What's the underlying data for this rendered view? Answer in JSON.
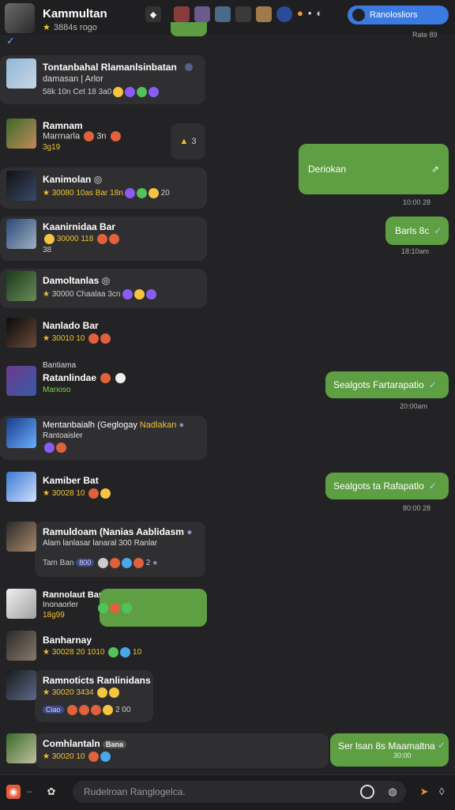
{
  "header": {
    "title": "Kammultan",
    "subtitle": "3884s   rogo",
    "button_label": "Ranolosliors",
    "time": "Rate 89"
  },
  "rows": [
    {
      "name": "Tontanbahal Rlamanlsinbatan",
      "line2": "damasan | Arlor",
      "meta": "58k  10n  Cet  18  3a0"
    },
    {
      "name": "Ramnam",
      "line2": "Marrnarla",
      "meta": "3g19",
      "extra": "3n"
    },
    {
      "name": "Kanimolan",
      "meta": "30080  10as  Bar  18n",
      "extra": "20"
    },
    {
      "name": "Kaanirnidaa Bar",
      "meta": "30000  118",
      "line3": "38"
    },
    {
      "name": "Damoltanlas",
      "meta": "30000  Chaalaa  3cn"
    },
    {
      "name": "Nanlado Bar",
      "meta": "30010   10"
    },
    {
      "name": "Bantiama",
      "line2": "Ratanlindae",
      "meta": "Manoso"
    },
    {
      "name": "Mentanbaialh (Geglogay",
      "highlight": "Nadlakan",
      "line2": "Rantoaisler",
      "meta": ""
    },
    {
      "name": "Kamiber Bat",
      "meta": "30028   10"
    },
    {
      "name": "Ramuldoam (Nanias Aablidasm",
      "line2": "Alam lanlasar lanaral  300 Ranlar",
      "meta": "Tam  Ban",
      "tag": "800",
      "extra": "2"
    },
    {
      "name": "Rannolaut Bar",
      "line2": "Inonaorler",
      "meta": "18g99"
    },
    {
      "name": "Banharnay",
      "meta": "30028   20  1010",
      "extra": "10"
    },
    {
      "name": "Ramnoticts Ranlinidans",
      "meta": "30020  3434",
      "tag": "Ciao",
      "extra": "2   00"
    },
    {
      "name": "Comhlantaln",
      "highlight": "Bana",
      "meta": "30020   10"
    }
  ],
  "outgoing": [
    {
      "text": "Deriokan",
      "time": "10:00 28"
    },
    {
      "text": "Barls 8c",
      "time": "18:10am"
    },
    {
      "text": "Sealgots Fartarapatio",
      "time": "20:00am"
    },
    {
      "text": "Sealgots ta Rafapatlo",
      "time": "80:00 28"
    },
    {
      "text": "Ser lsan 8s Maamaltna",
      "time": "30:00"
    }
  ],
  "reply_badge": {
    "text": "3"
  },
  "footer": {
    "placeholder": "Rudelroan Ranglogelca."
  },
  "colors": {
    "background": "#232325",
    "bubble_out": "#5e9f43",
    "card": "#2f2f32",
    "accent_blue": "#3b7ae0",
    "star": "#f1c232"
  }
}
